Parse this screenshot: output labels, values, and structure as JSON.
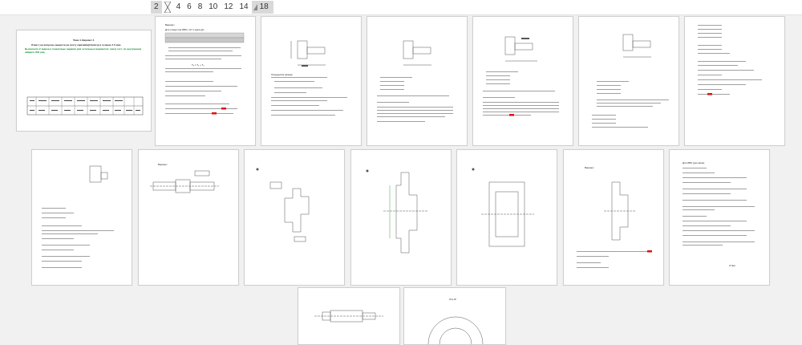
{
  "zoom_bar": {
    "levels": [
      "2",
      "3",
      "4",
      "6",
      "8",
      "10",
      "12",
      "14",
      "18"
    ],
    "selected": "2",
    "pinned": "18"
  },
  "page1": {
    "title": "Тема 4. Вариант 4",
    "line1": "Ответ ( на вопросы вывести на почту vapiskala@mail.ru) в течение 4 5 мин",
    "line2": "Выполните 2 задачи и пошаговые задания для остальных вариантов: сразу тест, по внутренним найдите ISO ряд"
  },
  "page2": {
    "heading": "Вариант",
    "line1": "Для отверстия Ø50 с H7 и вала g6...",
    "formula": "Tₙ = T₁ + T₂",
    "highlight": "0,06"
  },
  "page3": {
    "caption": "Определим размер"
  },
  "page7": {
    "mark": "IT/2"
  },
  "page9": {
    "note": "Вариант"
  },
  "page13": {
    "note": "Вариант"
  },
  "page16": {
    "title": "Для Ø50 (для вала)",
    "footer": "Ответ"
  },
  "page18": {
    "title": "Ось Ø"
  },
  "colors": {
    "background": "#f1f1f1",
    "page": "#ffffff",
    "highlight_red": "#d11",
    "highlight_yellow": "#ffe900"
  }
}
